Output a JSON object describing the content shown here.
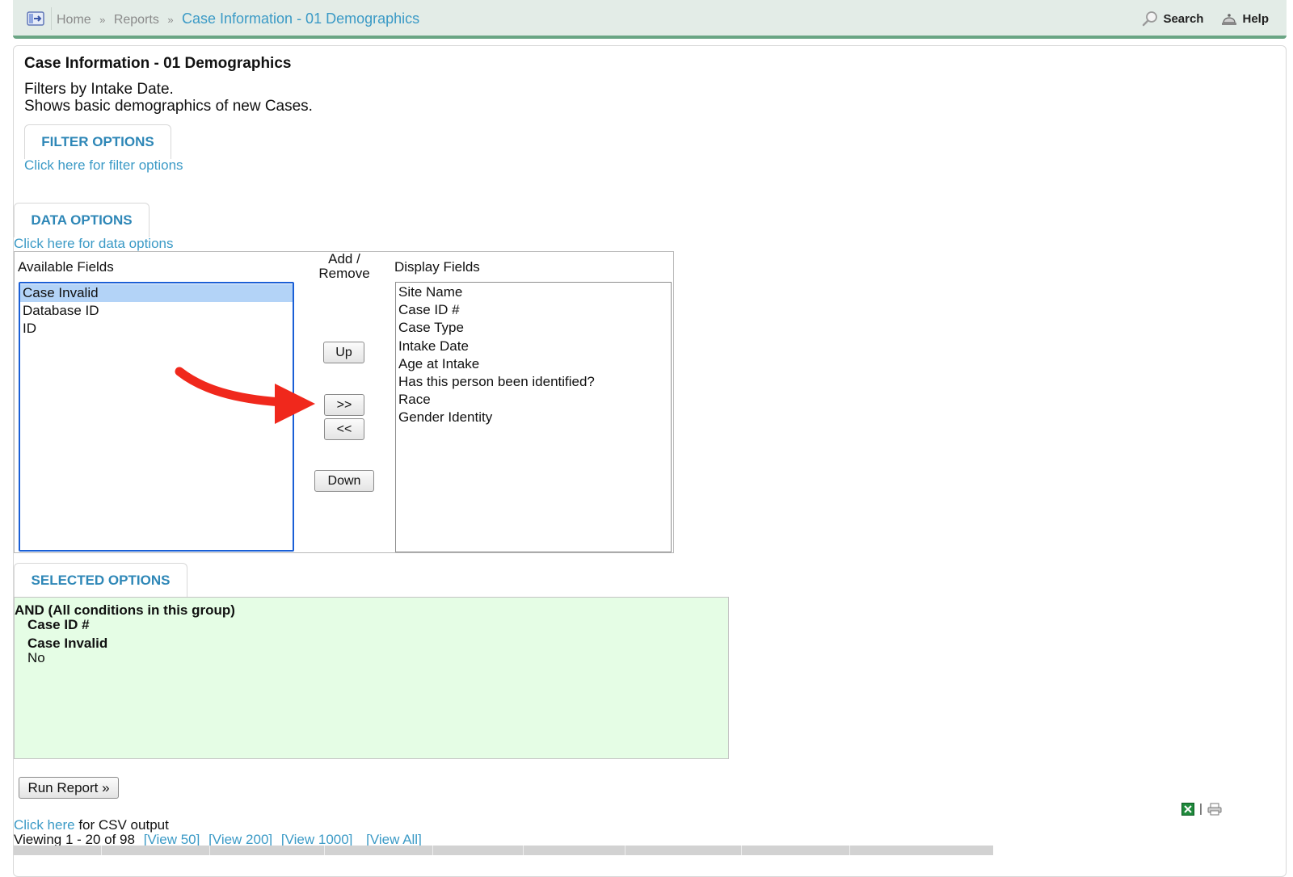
{
  "breadcrumb": {
    "home": "Home",
    "sep1": "»",
    "reports": "Reports",
    "sep2": "»",
    "current": "Case Information - 01 Demographics"
  },
  "top_actions": {
    "search": "Search",
    "help": "Help"
  },
  "page": {
    "title": "Case Information - 01 Demographics",
    "desc_line1": "Filters by Intake Date.",
    "desc_line2": "Shows basic demographics of new Cases."
  },
  "filter_options": {
    "tab_label": "FILTER OPTIONS",
    "link": "Click here for filter options"
  },
  "data_options": {
    "tab_label": "DATA OPTIONS",
    "link": "Click here for data options",
    "available_label": "Available Fields",
    "add_remove_label_1": "Add /",
    "add_remove_label_2": "Remove",
    "display_label": "Display Fields",
    "available_fields": [
      "Case Invalid",
      "Database ID",
      "ID"
    ],
    "selected_available": "Case Invalid",
    "display_fields": [
      "Site Name",
      "Case ID #",
      "Case Type",
      "Intake Date",
      "Age at Intake",
      "Has this person been identified?",
      "Race",
      "Gender Identity"
    ],
    "buttons": {
      "up": "Up",
      "add": ">>",
      "remove": "<<",
      "down": "Down"
    }
  },
  "selected_options": {
    "tab_label": "SELECTED OPTIONS",
    "group_label": "AND (All conditions in this group)",
    "condition1_key": "Case ID #",
    "condition2_key": "Case Invalid",
    "condition2_value": "No"
  },
  "run_report": "Run Report »",
  "csv": {
    "link": "Click here",
    "text": " for CSV output"
  },
  "viewing": {
    "text": "Viewing 1 - 20 of 98",
    "view50": "[View 50]",
    "view200": "[View 200]",
    "view1000": "[View 1000]",
    "viewall": "[View All]"
  },
  "colors": {
    "accent": "#3b9ac6",
    "tab_text": "#2e87b7",
    "topbar": "#e3ece7",
    "topbar_border": "#6aa584",
    "selected_bg": "#e5fde5",
    "annotation_arrow": "#f0281c"
  },
  "icons": [
    "menu-toggle-icon",
    "search-icon",
    "help-icon",
    "excel-icon",
    "print-icon",
    "annotation-arrow"
  ]
}
